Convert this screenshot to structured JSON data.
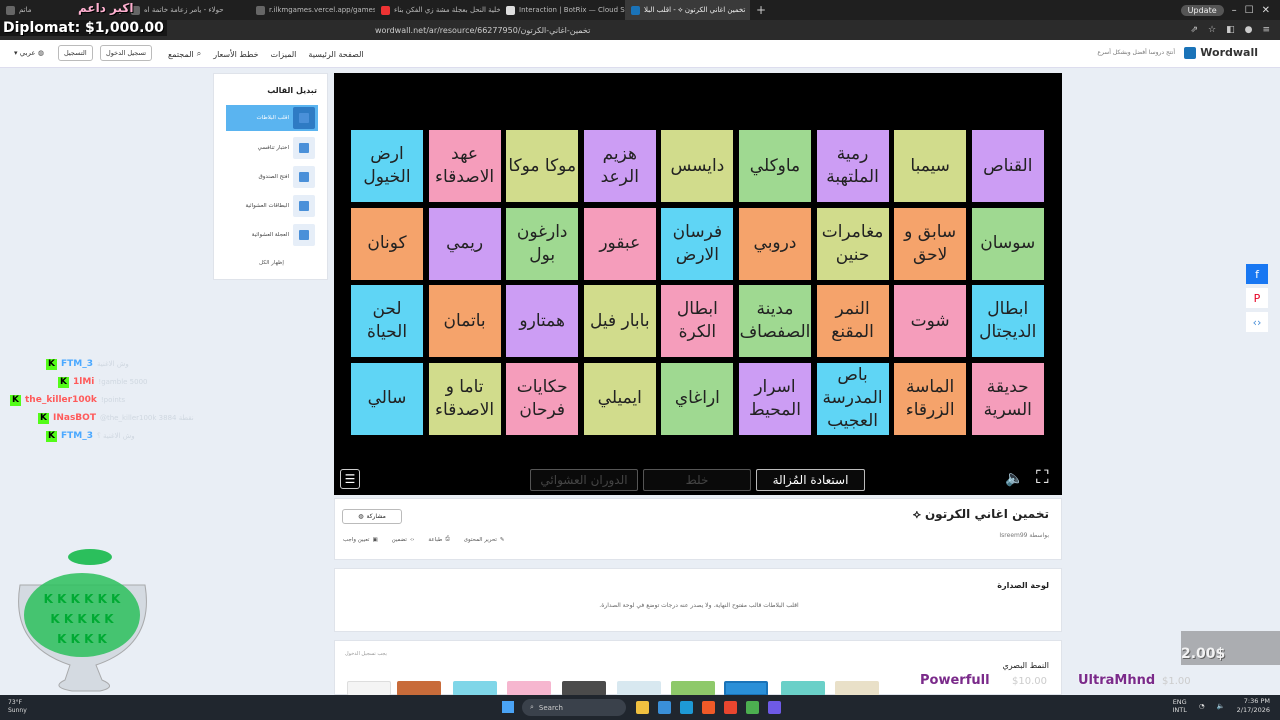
{
  "browser": {
    "tabs": [
      {
        "label": "ماتم",
        "active": false
      },
      {
        "label": "حولاء - يامر زعامة خاتمة اه",
        "active": false
      },
      {
        "label": "r.ilkmgames.vercel.app/games/whee",
        "active": false
      },
      {
        "label": "خلية النحل بعجلة مشة زي الفكن بناء!",
        "active": false
      },
      {
        "label": "Interaction | BotRix — Cloud Stream",
        "active": false
      },
      {
        "label": "تخمين اغاني الكرتون ⟡ - اقلب البلا",
        "active": true
      }
    ],
    "url": "wordwall.net/ar/resource/66277950/تخمين-اغاني-الكرتون",
    "update_label": "Update"
  },
  "site": {
    "logo_text": "Wordwall",
    "tagline": "أنتج دروسا أفضل وبشكل أسرع",
    "nav": [
      "الصفحة الرئيسية",
      "الميزات",
      "خطط الأسعار",
      "المجتمع"
    ],
    "signup_label": "تسجيل الدخول",
    "register_label": "التسجيل",
    "lang_label": "عربي"
  },
  "templates": {
    "title": "تبديل القالب",
    "items": [
      {
        "label": "اقلب البلاطات",
        "selected": true
      },
      {
        "label": "اختبار تنافسي",
        "selected": false
      },
      {
        "label": "افتح الصندوق",
        "selected": false
      },
      {
        "label": "البطاقات العشوائية",
        "selected": false
      },
      {
        "label": "العجلة العشوائية",
        "selected": false
      }
    ],
    "show_all": "إظهار الكل"
  },
  "game": {
    "tiles": [
      {
        "text": "ارض الخيول",
        "color": "blue"
      },
      {
        "text": "عهد الاصدقاء",
        "color": "pink"
      },
      {
        "text": "موكا موكا",
        "color": "lime"
      },
      {
        "text": "هزيم الرعد",
        "color": "purple"
      },
      {
        "text": "دايسس",
        "color": "lime"
      },
      {
        "text": "ماوكلي",
        "color": "green"
      },
      {
        "text": "رمية الملتهبة",
        "color": "purple"
      },
      {
        "text": "سيمبا",
        "color": "lime"
      },
      {
        "text": "القناص",
        "color": "purple"
      },
      {
        "text": "كونان",
        "color": "orange"
      },
      {
        "text": "ريمي",
        "color": "purple"
      },
      {
        "text": "دارغون بول",
        "color": "green"
      },
      {
        "text": "عبقور",
        "color": "pink"
      },
      {
        "text": "فرسان الارض",
        "color": "blue"
      },
      {
        "text": "دروبي",
        "color": "orange"
      },
      {
        "text": "مغامرات حنين",
        "color": "lime"
      },
      {
        "text": "سابق و لاحق",
        "color": "orange"
      },
      {
        "text": "سوسان",
        "color": "green"
      },
      {
        "text": "لحن الحياة",
        "color": "blue"
      },
      {
        "text": "باتمان",
        "color": "orange"
      },
      {
        "text": "همتارو",
        "color": "purple"
      },
      {
        "text": "بابار فيل",
        "color": "lime"
      },
      {
        "text": "ابطال الكرة",
        "color": "pink"
      },
      {
        "text": "مدينة الصفصاف",
        "color": "green"
      },
      {
        "text": "النمر المقنع",
        "color": "orange"
      },
      {
        "text": "شوت",
        "color": "pink"
      },
      {
        "text": "ابطال الديجتال",
        "color": "blue"
      },
      {
        "text": "سالي",
        "color": "blue"
      },
      {
        "text": "تاما و الاصدقاء",
        "color": "lime"
      },
      {
        "text": "حكايات فرحان",
        "color": "pink"
      },
      {
        "text": "ايميلي",
        "color": "lime"
      },
      {
        "text": "اراغاي",
        "color": "green"
      },
      {
        "text": "اسرار المحيط",
        "color": "purple"
      },
      {
        "text": "باص المدرسة العجيب",
        "color": "blue"
      },
      {
        "text": "الماسة الزرقاء",
        "color": "orange"
      },
      {
        "text": "حديقة السرية",
        "color": "pink"
      }
    ],
    "controls": {
      "restore_label": "استعادة المُزالة",
      "shuffle_label": "خلط",
      "random_spin_label": "الدوران العشوائي"
    }
  },
  "info": {
    "title": "تخمين اغاني الكرتون ⟡",
    "author": "بواسطة Isreem99",
    "share_label": "مشاركة",
    "actions": [
      "تعيين واجب",
      "تضمين",
      "طباعة",
      "تحرير المحتوى"
    ]
  },
  "leaderboard": {
    "title": "لوحة الصدارة",
    "text": "اقلب البلاطات قالب مفتوح النهاية. ولا يصدر عنه درجات توضع في لوحة الصدارة."
  },
  "style_section": {
    "title": "النمط البصري",
    "login_note": "يجب تسجيل الدخول"
  },
  "overlay": {
    "diplomat": "Diplomat: $1,000.00",
    "streamer_name": "اكبر داعم",
    "chat": [
      {
        "user": "FTM_3",
        "msg": "وش الاغنية",
        "color": "#4aa8ff"
      },
      {
        "user": "1lMi",
        "msg": "!gamble 5000",
        "color": "#ff5a5a"
      },
      {
        "user": "the_killer100k",
        "msg": "!points",
        "color": "#ff5a5a"
      },
      {
        "user": "INasBOT",
        "msg": "@the_killer100k 3884 نقطة",
        "color": "#ff5a5a"
      },
      {
        "user": "FTM_3",
        "msg": "وش الاغنية ؟",
        "color": "#4aa8ff"
      }
    ],
    "donation_amount": "2.00$",
    "donors": [
      {
        "name": "Powerfull",
        "amount": "$10.00"
      },
      {
        "name": "UltraMhnd",
        "amount": "$1.00"
      }
    ]
  },
  "taskbar": {
    "weather_temp": "73°F",
    "weather_desc": "Sunny",
    "search_label": "Search",
    "lang": "ENG",
    "lang_sub": "INTL",
    "time": "7:36 PM",
    "date": "2/17/2026"
  }
}
